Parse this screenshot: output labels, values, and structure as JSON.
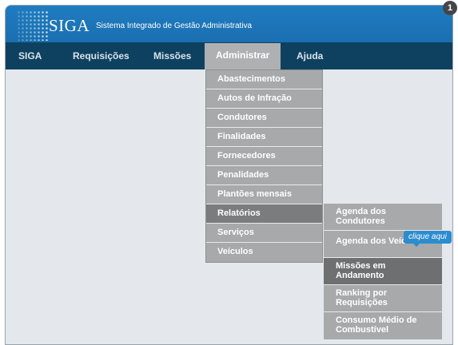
{
  "header": {
    "logo_text": "SIGA",
    "system_name": "Sistema Integrado de Gestão Administrativa"
  },
  "navbar": {
    "items": [
      {
        "label": "SIGA"
      },
      {
        "label": "Requisições"
      },
      {
        "label": "Missões"
      },
      {
        "label": "Administrar"
      },
      {
        "label": "Ajuda"
      }
    ],
    "active_item": "Administrar"
  },
  "admin_menu": {
    "items": [
      {
        "label": "Abastecimentos"
      },
      {
        "label": "Autos de Infração"
      },
      {
        "label": "Condutores"
      },
      {
        "label": "Finalidades"
      },
      {
        "label": "Fornecedores"
      },
      {
        "label": "Penalidades"
      },
      {
        "label": "Plantões mensais"
      },
      {
        "label": "Relatórios"
      },
      {
        "label": "Serviços"
      },
      {
        "label": "Veículos"
      }
    ],
    "active_item": "Relatórios"
  },
  "reports_submenu": {
    "items": [
      {
        "label": "Agenda dos Condutores"
      },
      {
        "label": "Agenda dos Veículos"
      },
      {
        "label": "Missões em Andamento"
      },
      {
        "label": "Ranking por Requisições"
      },
      {
        "label": "Consumo Médio de Combustível"
      }
    ],
    "highlighted_item": "Missões em Andamento"
  },
  "tooltip": {
    "text": "clique aqui"
  },
  "step_badge": {
    "number": "1"
  },
  "colors": {
    "banner": "#1a6fb0",
    "navbar": "#0e4160",
    "menu": "#a7a9ab",
    "menu_active": "#7a7c7e",
    "tooltip": "#2b8ccf"
  }
}
